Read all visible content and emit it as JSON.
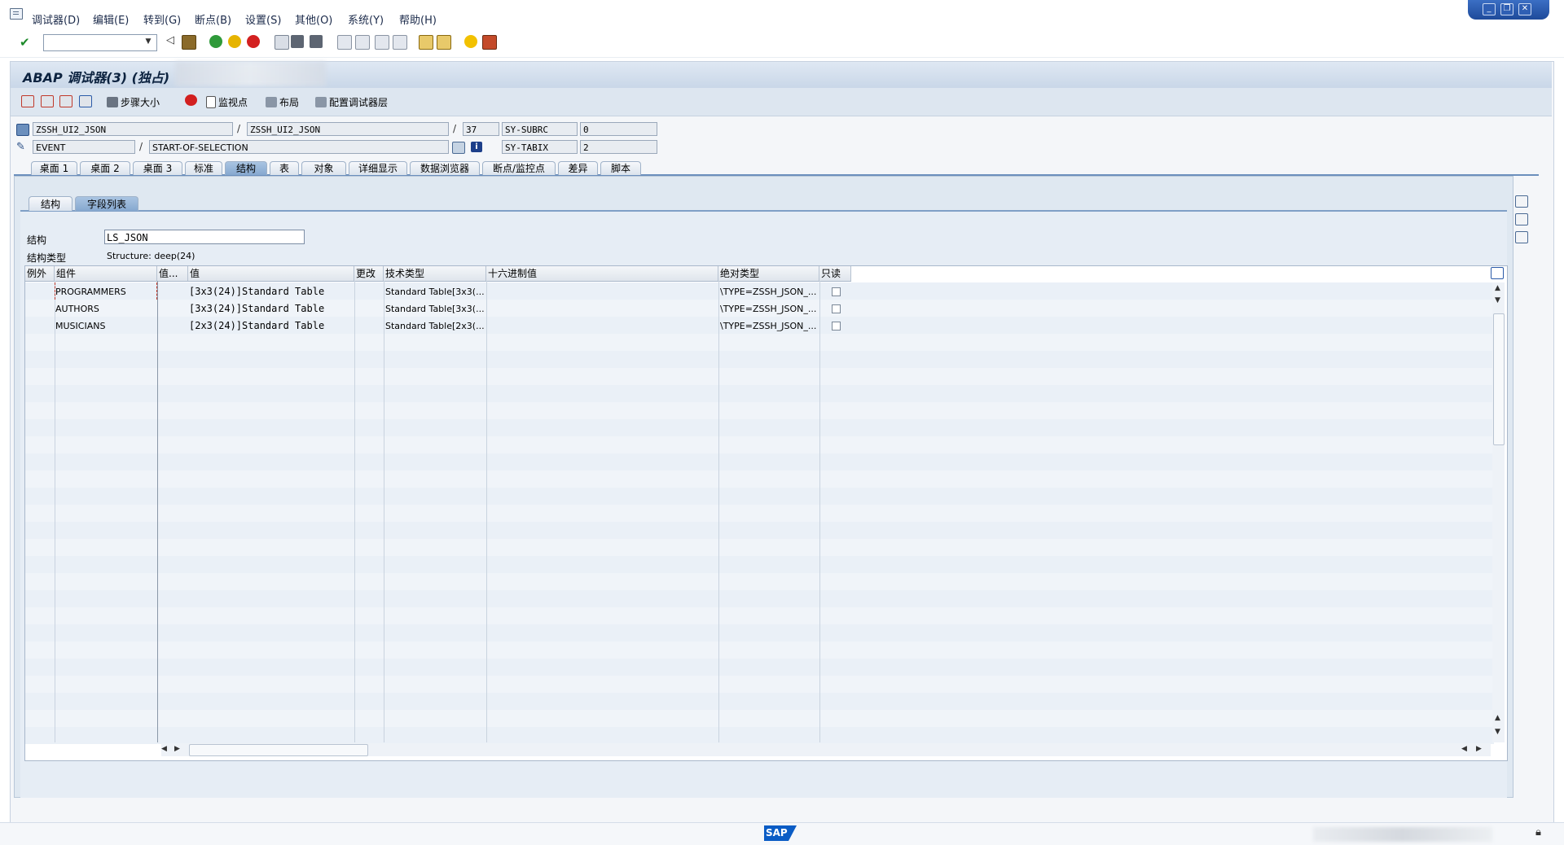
{
  "menu": [
    "调试器(D)",
    "编辑(E)",
    "转到(G)",
    "断点(B)",
    "设置(S)",
    "其他(O)",
    "系统(Y)",
    "帮助(H)"
  ],
  "window_controls": [
    "_",
    "❐",
    "✕"
  ],
  "title": "ABAP 调试器(3) (独占)",
  "app_toolbar": {
    "step_size": "步骤大小",
    "watchpoint": "监视点",
    "layout": "布局",
    "configure_layers": "配置调试器层"
  },
  "fields": {
    "program": "ZSSH_UI2_JSON",
    "include": "ZSSH_UI2_JSON",
    "line": "37",
    "sysvar1_name": "SY-SUBRC",
    "sysvar1_value": "0",
    "event_type": "EVENT",
    "event_name": "START-OF-SELECTION",
    "sysvar2_name": "SY-TABIX",
    "sysvar2_value": "2",
    "sep": "/"
  },
  "tabs": [
    "桌面 1",
    "桌面 2",
    "桌面 3",
    "标准",
    "结构",
    "表",
    "对象",
    "详细显示",
    "数据浏览器",
    "断点/监控点",
    "差异",
    "脚本"
  ],
  "active_tab": "结构",
  "subtabs": [
    "结构",
    "字段列表"
  ],
  "active_subtab": "字段列表",
  "structure": {
    "label": "结构",
    "value": "LS_JSON",
    "type_label": "结构类型",
    "type_value": "Structure: deep(24)"
  },
  "grid": {
    "columns": [
      "例外",
      "组件",
      "值...",
      "值",
      "更改",
      "技术类型",
      "十六进制值",
      "绝对类型",
      "只读"
    ],
    "rows": [
      {
        "component": "PROGRAMMERS",
        "value": "[3x3(24)]Standard Table",
        "tech_type": "Standard Table[3x3(...",
        "abs_type": "\\TYPE=ZSSH_JSON_...",
        "readonly": false
      },
      {
        "component": "AUTHORS",
        "value": "[3x3(24)]Standard Table",
        "tech_type": "Standard Table[3x3(...",
        "abs_type": "\\TYPE=ZSSH_JSON_...",
        "readonly": false
      },
      {
        "component": "MUSICIANS",
        "value": "[2x3(24)]Standard Table",
        "tech_type": "Standard Table[2x3(...",
        "abs_type": "\\TYPE=ZSSH_JSON_...",
        "readonly": false
      }
    ]
  },
  "status": {
    "logo": "SAP"
  },
  "colors": {
    "accent": "#86a8cf",
    "sap_logo": "#0a5cc5"
  }
}
